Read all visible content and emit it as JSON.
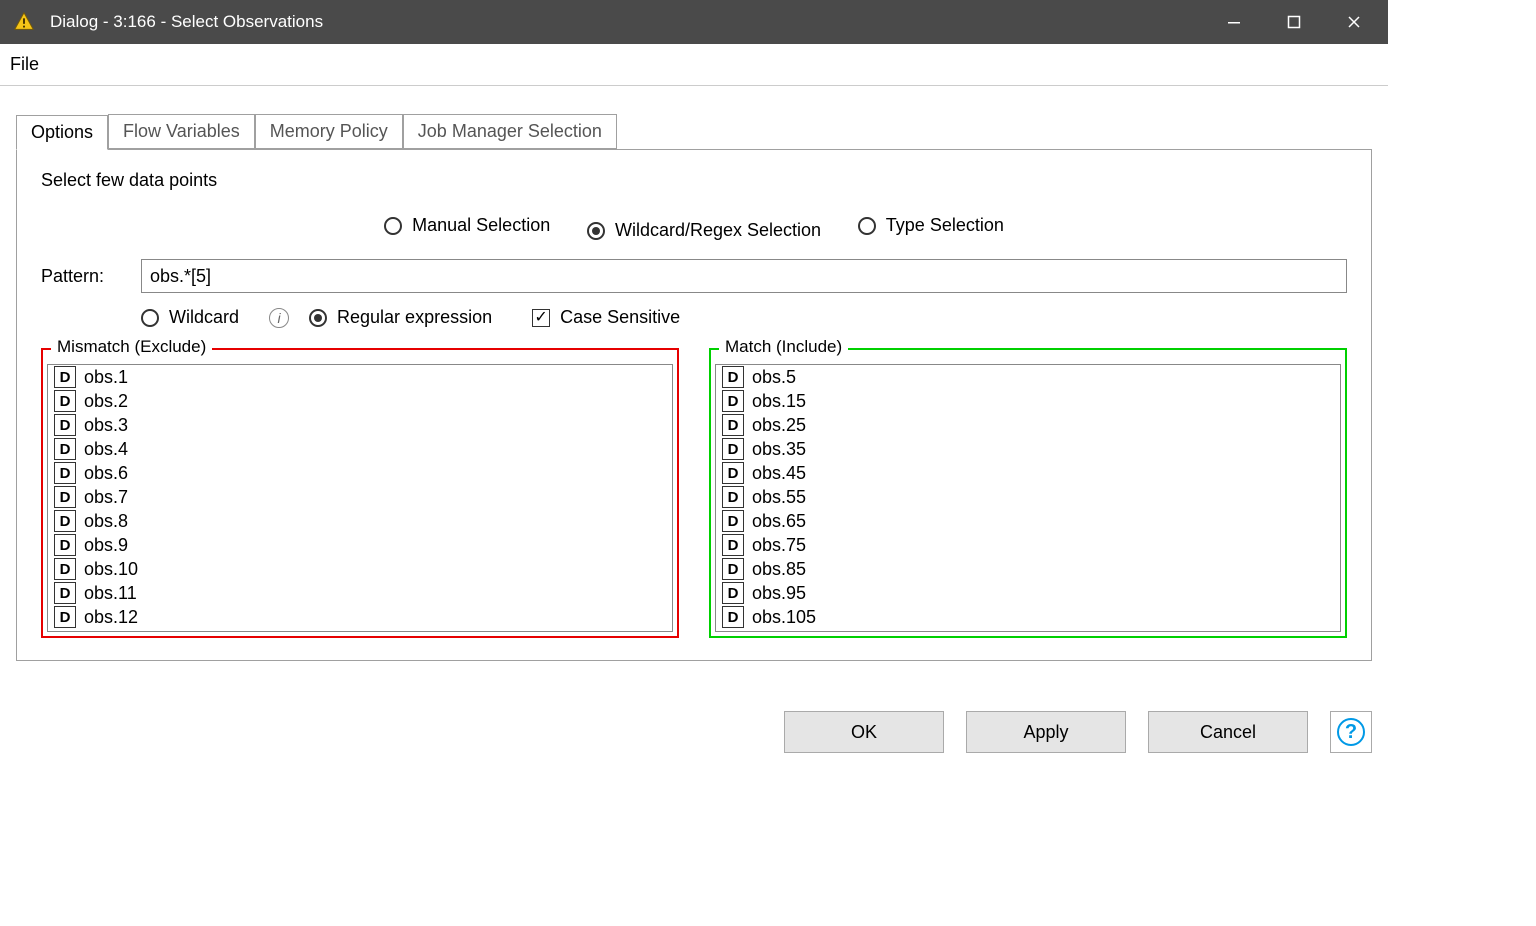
{
  "window": {
    "title": "Dialog - 3:166 - Select Observations"
  },
  "menubar": {
    "file": "File"
  },
  "tabs": {
    "options": "Options",
    "flow": "Flow Variables",
    "memory": "Memory Policy",
    "jobmgr": "Job Manager Selection"
  },
  "section_title": "Select few data points",
  "mode": {
    "manual": "Manual Selection",
    "wildcard_regex": "Wildcard/Regex Selection",
    "type": "Type Selection"
  },
  "pattern": {
    "label": "Pattern:",
    "value": "obs.*[5]"
  },
  "opts": {
    "wildcard": "Wildcard",
    "regex": "Regular expression",
    "case": "Case Sensitive"
  },
  "exclude": {
    "legend": "Mismatch (Exclude)",
    "items": [
      "obs.1",
      "obs.2",
      "obs.3",
      "obs.4",
      "obs.6",
      "obs.7",
      "obs.8",
      "obs.9",
      "obs.10",
      "obs.11",
      "obs.12"
    ]
  },
  "include": {
    "legend": "Match (Include)",
    "items": [
      "obs.5",
      "obs.15",
      "obs.25",
      "obs.35",
      "obs.45",
      "obs.55",
      "obs.65",
      "obs.75",
      "obs.85",
      "obs.95",
      "obs.105"
    ]
  },
  "buttons": {
    "ok": "OK",
    "apply": "Apply",
    "cancel": "Cancel"
  },
  "icons": {
    "data_type_letter": "D"
  }
}
